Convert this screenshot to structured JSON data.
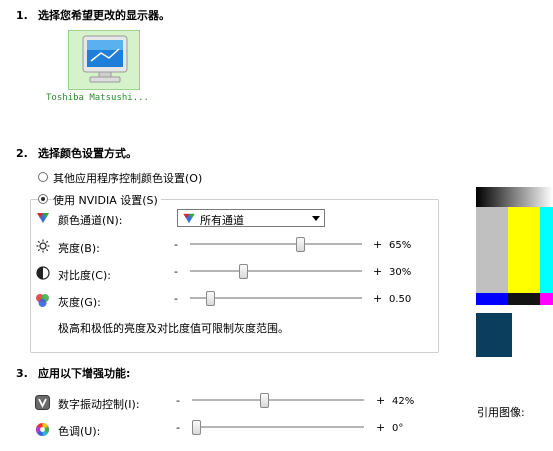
{
  "section1": {
    "number": "1.",
    "title": "选择您希望更改的显示器。"
  },
  "monitor": {
    "name": "Toshiba Matsushi..."
  },
  "section2": {
    "number": "2.",
    "title": "选择颜色设置方式。",
    "option_other": "其他应用程序控制颜色设置(O)",
    "option_nvidia": "使用 NVIDIA 设置(S)",
    "channel": {
      "label": "颜色通道(N):",
      "selected": "所有通道"
    },
    "brightness": {
      "label": "亮度(B):",
      "minus": "-",
      "plus": "+",
      "value": "65%",
      "level": 0.65
    },
    "contrast": {
      "label": "对比度(C):",
      "minus": "-",
      "plus": "+",
      "value": "30%",
      "level": 0.3
    },
    "gamma": {
      "label": "灰度(G):",
      "minus": "-",
      "plus": "+",
      "value": "0.50",
      "level": 0.1
    },
    "note": "极高和极低的亮度及对比度值可限制灰度范围。"
  },
  "section3": {
    "number": "3.",
    "title": "应用以下增强功能:",
    "vibrance": {
      "label": "数字振动控制(I):",
      "minus": "-",
      "plus": "+",
      "value": "42%",
      "level": 0.42
    },
    "hue": {
      "label": "色调(U):",
      "minus": "-",
      "plus": "+",
      "value": "0°",
      "level": 0.0
    }
  },
  "reference": {
    "label": "引用图像:"
  },
  "colors": {
    "monitor_green": "#d6f2cb",
    "caption_green": "#2f8a2f"
  }
}
